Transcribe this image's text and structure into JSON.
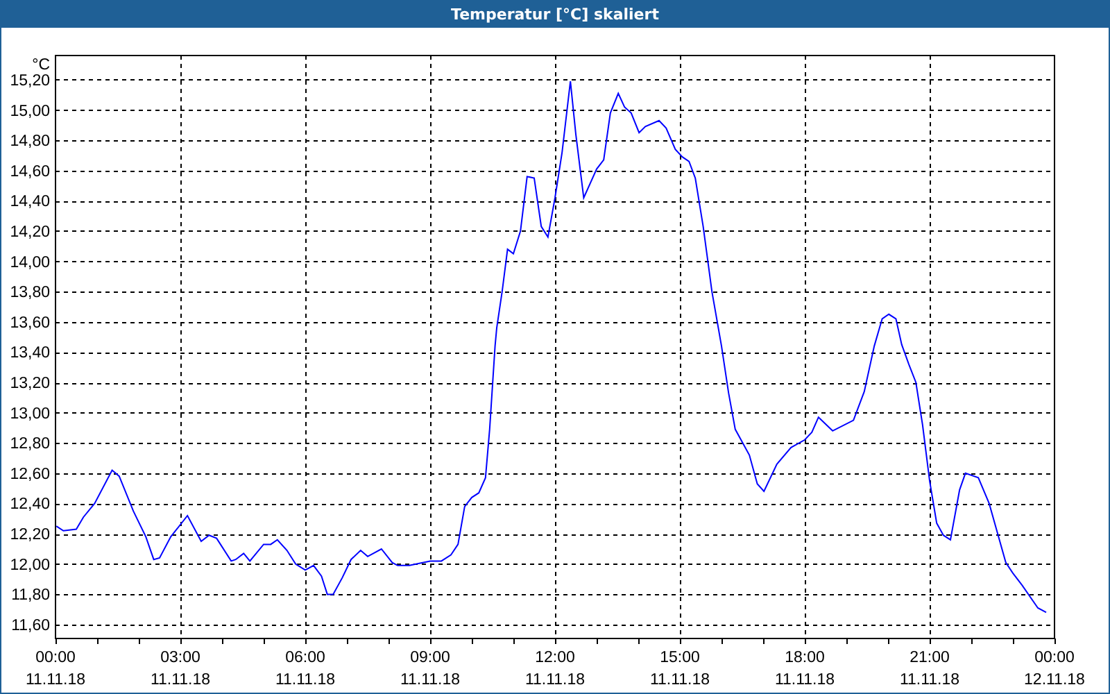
{
  "window": {
    "title": "Temperatur [°C] skaliert"
  },
  "chart": {
    "x_axis_dates": [
      "11.11.18",
      "11.11.18",
      "11.11.18",
      "11.11.18",
      "11.11.18",
      "11.11.18",
      "11.11.18",
      "11.11.18",
      "12.11.18"
    ],
    "chart_data": {
      "type": "line",
      "ylabel": "°C",
      "xlim": [
        0,
        24
      ],
      "ylim": [
        11.508,
        15.36
      ],
      "yticks": [
        {
          "value": 11.6,
          "label": "11,60"
        },
        {
          "value": 11.8,
          "label": "11,80"
        },
        {
          "value": 12.0,
          "label": "12,00"
        },
        {
          "value": 12.2,
          "label": "12,20"
        },
        {
          "value": 12.4,
          "label": "12,40"
        },
        {
          "value": 12.6,
          "label": "12,60"
        },
        {
          "value": 12.8,
          "label": "12,80"
        },
        {
          "value": 13.0,
          "label": "13,00"
        },
        {
          "value": 13.2,
          "label": "13,20"
        },
        {
          "value": 13.4,
          "label": "13,40"
        },
        {
          "value": 13.6,
          "label": "13,60"
        },
        {
          "value": 13.8,
          "label": "13,80"
        },
        {
          "value": 14.0,
          "label": "14,00"
        },
        {
          "value": 14.2,
          "label": "14,20"
        },
        {
          "value": 14.4,
          "label": "14,40"
        },
        {
          "value": 14.6,
          "label": "14,60"
        },
        {
          "value": 14.8,
          "label": "14,80"
        },
        {
          "value": 15.0,
          "label": "15,00"
        },
        {
          "value": 15.2,
          "label": "15,20"
        }
      ],
      "grid": true,
      "xticks": [
        {
          "value": 0,
          "label": "00:00"
        },
        {
          "value": 3,
          "label": "03:00"
        },
        {
          "value": 6,
          "label": "06:00"
        },
        {
          "value": 9,
          "label": "09:00"
        },
        {
          "value": 12,
          "label": "12:00"
        },
        {
          "value": 15,
          "label": "15:00"
        },
        {
          "value": 18,
          "label": "18:00"
        },
        {
          "value": 21,
          "label": "21:00"
        },
        {
          "value": 24,
          "label": "00:00"
        }
      ],
      "x": [
        0.02,
        0.19,
        0.5,
        0.67,
        0.94,
        1.36,
        1.53,
        1.87,
        2.17,
        2.36,
        2.5,
        2.77,
        3.17,
        3.5,
        3.69,
        3.87,
        4.22,
        4.33,
        4.52,
        4.67,
        5.0,
        5.17,
        5.33,
        5.56,
        5.77,
        6.0,
        6.2,
        6.39,
        6.53,
        6.67,
        6.89,
        7.1,
        7.33,
        7.5,
        7.83,
        8.09,
        8.22,
        8.5,
        9.0,
        9.27,
        9.5,
        9.67,
        9.83,
        10.0,
        10.17,
        10.33,
        10.43,
        10.56,
        10.6,
        10.73,
        10.86,
        11.0,
        11.17,
        11.33,
        11.5,
        11.67,
        11.83,
        12.0,
        12.17,
        12.37,
        12.5,
        12.69,
        13.0,
        13.17,
        13.33,
        13.52,
        13.67,
        13.83,
        14.02,
        14.17,
        14.5,
        14.67,
        14.89,
        15.06,
        15.22,
        15.37,
        15.56,
        15.77,
        16.0,
        16.17,
        16.33,
        16.67,
        16.86,
        17.02,
        17.33,
        17.67,
        18.0,
        18.17,
        18.33,
        18.67,
        19.17,
        19.43,
        19.67,
        19.86,
        20.02,
        20.19,
        20.33,
        20.5,
        20.67,
        20.83,
        21.0,
        21.17,
        21.33,
        21.5,
        21.72,
        21.86,
        22.17,
        22.43,
        22.83,
        23.0,
        23.22,
        23.6,
        23.8
      ],
      "series": [
        {
          "color": "#0000ff",
          "values": [
            12.25,
            12.22,
            12.23,
            12.31,
            12.4,
            12.62,
            12.58,
            12.35,
            12.18,
            12.03,
            12.04,
            12.18,
            12.32,
            12.15,
            12.19,
            12.17,
            12.02,
            12.03,
            12.07,
            12.02,
            12.13,
            12.13,
            12.16,
            12.09,
            12.0,
            11.96,
            11.99,
            11.92,
            11.8,
            11.8,
            11.91,
            12.03,
            12.09,
            12.05,
            12.1,
            12.01,
            11.99,
            11.99,
            12.02,
            12.02,
            12.06,
            12.13,
            12.38,
            12.44,
            12.47,
            12.57,
            12.89,
            13.44,
            13.56,
            13.8,
            14.08,
            14.05,
            14.2,
            14.56,
            14.55,
            14.23,
            14.16,
            14.42,
            14.72,
            15.19,
            14.84,
            14.42,
            14.61,
            14.67,
            14.98,
            15.11,
            15.02,
            14.98,
            14.85,
            14.89,
            14.93,
            14.88,
            14.74,
            14.69,
            14.66,
            14.55,
            14.23,
            13.8,
            13.44,
            13.13,
            12.89,
            12.72,
            12.53,
            12.48,
            12.66,
            12.77,
            12.82,
            12.87,
            12.97,
            12.88,
            12.95,
            13.14,
            13.44,
            13.62,
            13.65,
            13.62,
            13.45,
            13.32,
            13.2,
            12.92,
            12.55,
            12.27,
            12.19,
            12.16,
            12.49,
            12.6,
            12.57,
            12.4,
            12.01,
            11.94,
            11.86,
            11.71,
            11.68
          ]
        }
      ]
    }
  }
}
